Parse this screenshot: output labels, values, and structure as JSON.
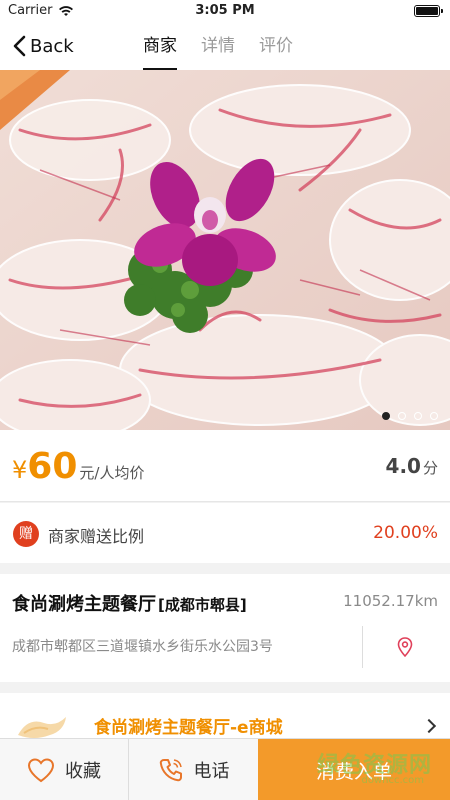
{
  "status_bar": {
    "carrier": "Carrier",
    "time": "3:05 PM"
  },
  "nav": {
    "back_label": "Back",
    "tabs": [
      {
        "label": "商家",
        "active": true
      },
      {
        "label": "详情",
        "active": false
      },
      {
        "label": "评价",
        "active": false
      }
    ]
  },
  "banner": {
    "slide_count": 4,
    "active_slide": 1
  },
  "price": {
    "symbol": "¥",
    "value": "60",
    "unit": "元/人均价"
  },
  "rating": {
    "value": "4.0",
    "unit": "分"
  },
  "gift": {
    "badge": "赠",
    "label": "商家赠送比例",
    "value": "20.00%"
  },
  "store": {
    "name": "食尚涮烤主题餐厅",
    "city": "[成都市郫县]",
    "distance": "11052.17km",
    "address": "成都市郫都区三道堰镇水乡街乐水公园3号"
  },
  "shop": {
    "name": "食尚涮烤主题餐厅-e商城"
  },
  "bottom_bar": {
    "favorite_label": "收藏",
    "phone_label": "电话",
    "order_label": "消费入单"
  },
  "watermark": {
    "text": "绿色资源网",
    "sub": "downcc.com"
  },
  "colors": {
    "accent_orange": "#f08f00",
    "order_button": "#f39a2a",
    "gift_red": "#e0401f"
  }
}
